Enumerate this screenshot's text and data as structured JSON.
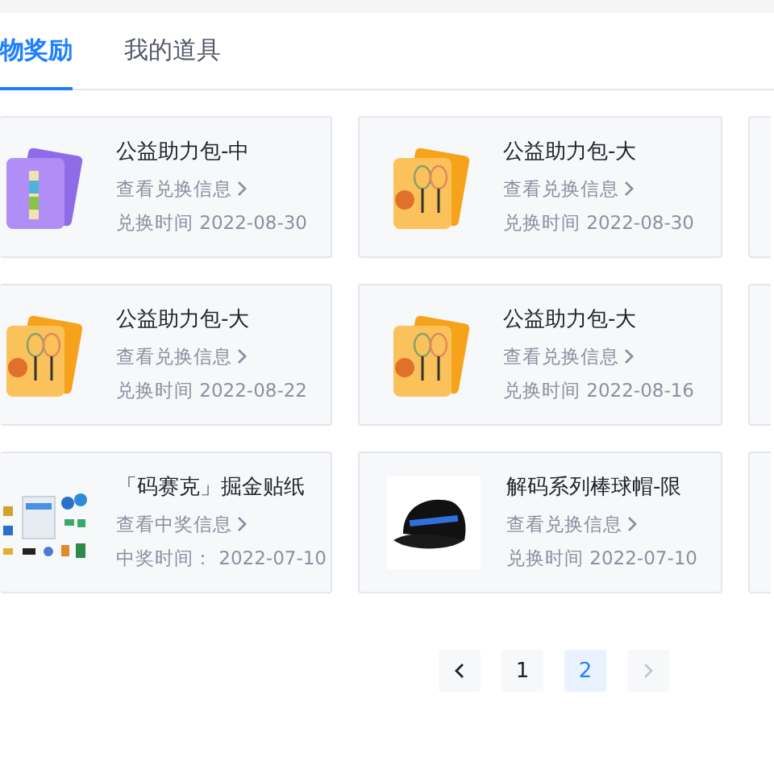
{
  "tabs": [
    {
      "label": "物奖励",
      "selected": true
    },
    {
      "label": "我的道具",
      "selected": false
    }
  ],
  "rows": [
    [
      {
        "kind": "purple-pack",
        "title": "公益助力包-中",
        "link": "查看兑换信息",
        "date": "兑换时间 2022-08-30"
      },
      {
        "kind": "orange-pack",
        "title": "公益助力包-大",
        "link": "查看兑换信息",
        "date": "兑换时间 2022-08-30"
      }
    ],
    [
      {
        "kind": "orange-pack",
        "title": "公益助力包-大",
        "link": "查看兑换信息",
        "date": "兑换时间 2022-08-22"
      },
      {
        "kind": "orange-pack",
        "title": "公益助力包-大",
        "link": "查看兑换信息",
        "date": "兑换时间 2022-08-16"
      }
    ],
    [
      {
        "kind": "stickers",
        "title": "「码赛克」掘金贴纸",
        "link": "查看中奖信息",
        "date": "中奖时间： 2022-07-10"
      },
      {
        "kind": "cap",
        "title": "解码系列棒球帽-限",
        "link": "查看兑换信息",
        "date": "兑换时间 2022-07-10"
      }
    ]
  ],
  "pagination": {
    "prev_disabled": false,
    "next_disabled": true,
    "pages": [
      {
        "label": "1",
        "selected": false
      },
      {
        "label": "2",
        "selected": true
      }
    ]
  }
}
